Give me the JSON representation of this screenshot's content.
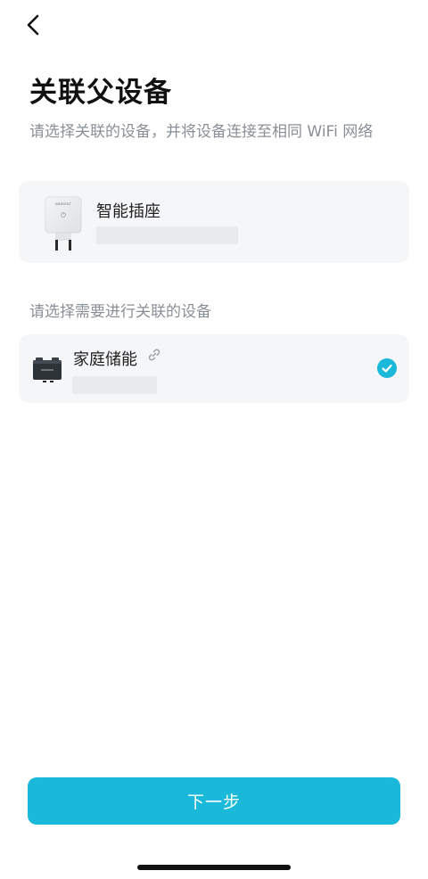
{
  "header": {
    "back_icon": "chevron-left-icon",
    "title": "关联父设备",
    "subtitle": "请选择关联的设备，并将设备连接至相同 WiFi 网络"
  },
  "parent_device": {
    "name": "智能插座",
    "brand_text": "INDEVOLT",
    "icon": "smart-plug-image"
  },
  "device_list": {
    "section_label": "请选择需要进行关联的设备",
    "items": [
      {
        "name": "家庭储能",
        "icon": "home-battery-image",
        "linked_icon": "link-icon",
        "selected": true
      }
    ]
  },
  "footer": {
    "next_label": "下一步"
  },
  "colors": {
    "accent": "#1bb9d9",
    "card_bg": "#f5f6f8",
    "placeholder": "#e9eaec",
    "muted_text": "#8a8f96"
  }
}
